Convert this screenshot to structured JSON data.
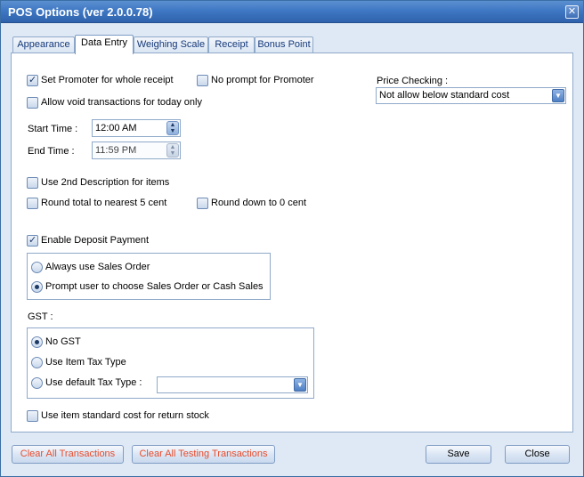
{
  "window": {
    "title": "POS Options (ver 2.0.0.78)",
    "close_glyph": "✕"
  },
  "tabs": [
    {
      "label": "Appearance",
      "active": false
    },
    {
      "label": "Data Entry",
      "active": true
    },
    {
      "label": "Weighing Scale",
      "active": false
    },
    {
      "label": "Receipt",
      "active": false
    },
    {
      "label": "Bonus Point",
      "active": false
    }
  ],
  "data_entry": {
    "set_promoter": {
      "label": "Set Promoter for whole receipt",
      "checked": true
    },
    "no_prompt_promoter": {
      "label": "No prompt for Promoter",
      "checked": false
    },
    "allow_void": {
      "label": "Allow void transactions for today only",
      "checked": false
    },
    "start_time": {
      "label": "Start Time :",
      "value": "12:00 AM"
    },
    "end_time": {
      "label": "End Time :",
      "value": "11:59 PM"
    },
    "use_2nd_description": {
      "label": "Use 2nd Description for items",
      "checked": false
    },
    "round_total": {
      "label": "Round total to nearest 5 cent",
      "checked": false
    },
    "round_down": {
      "label": "Round down to 0 cent",
      "checked": false
    },
    "enable_deposit": {
      "label": "Enable Deposit Payment",
      "checked": true
    },
    "deposit_options": [
      {
        "label": "Always use Sales Order",
        "selected": false
      },
      {
        "label": "Prompt user to choose Sales Order or Cash Sales",
        "selected": true
      }
    ],
    "gst": {
      "label": "GST :",
      "options": [
        {
          "label": "No GST",
          "selected": true
        },
        {
          "label": "Use Item Tax Type",
          "selected": false
        },
        {
          "label": "Use default Tax Type :",
          "selected": false
        }
      ],
      "default_tax_type_value": ""
    },
    "use_std_cost_return": {
      "label": "Use item standard cost for return stock",
      "checked": false
    },
    "price_checking": {
      "label": "Price Checking :",
      "value": "Not allow below standard cost"
    }
  },
  "footer": {
    "clear_all": "Clear All Transactions",
    "clear_testing": "Clear All Testing Transactions",
    "save": "Save",
    "close": "Close"
  },
  "colors": {
    "title_bar": "#3f78c4",
    "danger_text": "#e84c2c",
    "window_bg": "#dfe9f5"
  }
}
